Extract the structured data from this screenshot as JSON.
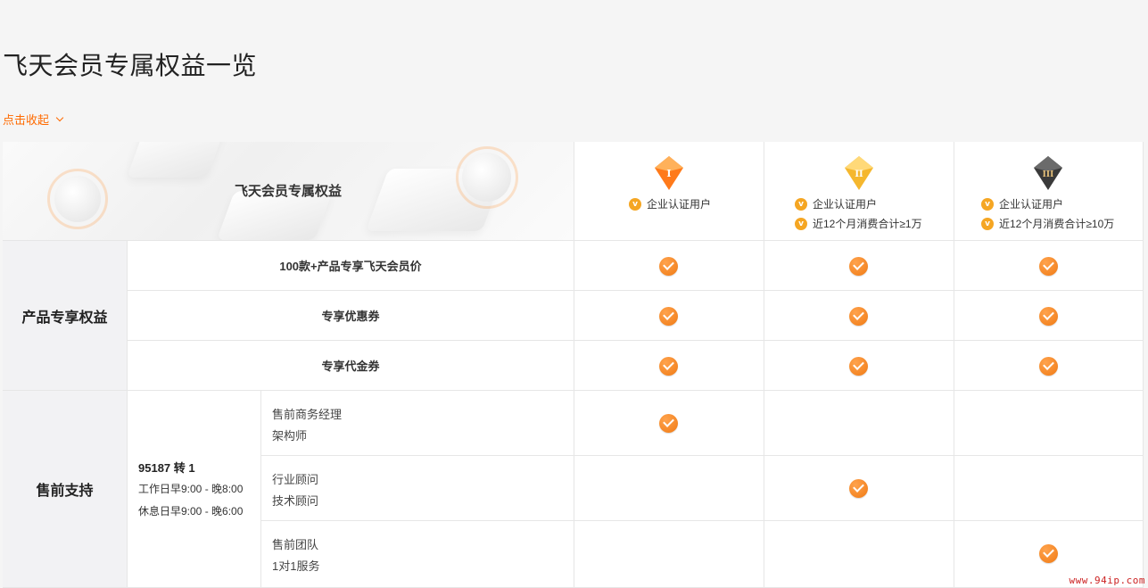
{
  "page": {
    "title": "飞天会员专属权益一览",
    "collapse_label": "点击收起"
  },
  "header": {
    "banner_title": "飞天会员专属权益",
    "tiers": [
      {
        "badge": "I",
        "badge_color": "#ff7a1a",
        "lines": [
          "企业认证用户"
        ]
      },
      {
        "badge": "II",
        "badge_color": "#f5b72e",
        "lines": [
          "企业认证用户",
          "近12个月消费合计≥1万"
        ]
      },
      {
        "badge": "III",
        "badge_color": "#3a3a3a",
        "lines": [
          "企业认证用户",
          "近12个月消费合计≥10万"
        ]
      }
    ],
    "v_icon": "v",
    "accent": "#ff6a00"
  },
  "groups": [
    {
      "label": "产品专享权益",
      "rows": [
        {
          "label": "100款+产品专享飞天会员价",
          "checks": [
            true,
            true,
            true
          ]
        },
        {
          "label": "专享优惠券",
          "checks": [
            true,
            true,
            true
          ]
        },
        {
          "label": "专享代金券",
          "checks": [
            true,
            true,
            true
          ]
        }
      ]
    },
    {
      "label": "售前支持",
      "contact": {
        "phone": "95187 转 1",
        "workday": "工作日早9:00 - 晚8:00",
        "restday": "休息日早9:00 - 晚6:00"
      },
      "rows": [
        {
          "label_lines": [
            "售前商务经理",
            "架构师"
          ],
          "checks": [
            true,
            false,
            false
          ]
        },
        {
          "label_lines": [
            "行业顾问",
            "技术顾问"
          ],
          "checks": [
            false,
            true,
            false
          ]
        },
        {
          "label_lines": [
            "售前团队",
            "1对1服务"
          ],
          "checks": [
            false,
            false,
            true
          ]
        }
      ]
    }
  ],
  "watermark": "www.94ip.com"
}
